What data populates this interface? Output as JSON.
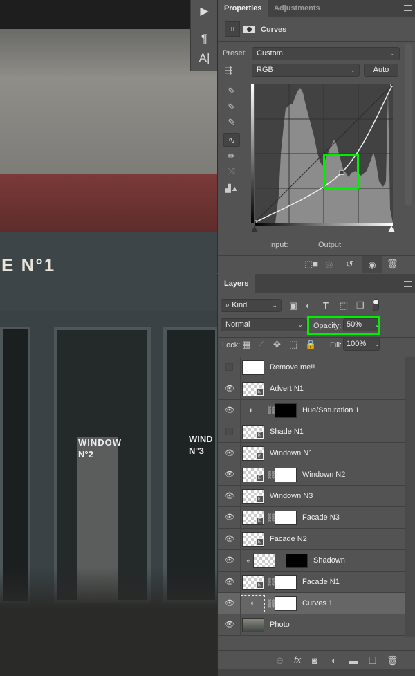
{
  "canvas": {
    "sign_text": "E N°1",
    "window2_text": "WINDOW",
    "window2_num": "N°2",
    "window3_text": "WIND",
    "window3_num": "N°3"
  },
  "toolstrip": {
    "icons": [
      "play-icon",
      "paragraph-icon",
      "character-icon"
    ],
    "paragraph": "¶",
    "character": "A|",
    "play": "▶"
  },
  "properties": {
    "tabs": [
      {
        "label": "Properties",
        "active": true
      },
      {
        "label": "Adjustments",
        "active": false
      }
    ],
    "title": "Curves",
    "preset_label": "Preset:",
    "preset_value": "Custom",
    "channel_value": "RGB",
    "auto_label": "Auto",
    "input_label": "Input:",
    "output_label": "Output:",
    "curve": {
      "points": [
        [
          0,
          0
        ],
        [
          161,
          93
        ],
        [
          255,
          255
        ]
      ],
      "range": [
        0,
        255
      ]
    },
    "highlight_color": "#00ee00"
  },
  "layers_panel": {
    "tab": "Layers",
    "filter_kind": "Kind",
    "blend_mode": "Normal",
    "opacity_label": "Opacity:",
    "opacity_value": "50%",
    "lock_label": "Lock:",
    "fill_label": "Fill:",
    "fill_value": "100%",
    "layers": [
      {
        "name": "Remove me!!",
        "visible": false,
        "type": "fill"
      },
      {
        "name": "Advert N1",
        "visible": true,
        "type": "smart"
      },
      {
        "name": "Hue/Saturation 1",
        "visible": true,
        "type": "adjust-black-mask"
      },
      {
        "name": "Shade N1",
        "visible": false,
        "type": "smart"
      },
      {
        "name": "Windown N1",
        "visible": true,
        "type": "smart"
      },
      {
        "name": "Windown N2",
        "visible": true,
        "type": "smart-mask"
      },
      {
        "name": "Windown N3",
        "visible": true,
        "type": "smart"
      },
      {
        "name": "Facade N3",
        "visible": true,
        "type": "smart-mask"
      },
      {
        "name": "Facade N2",
        "visible": true,
        "type": "smart"
      },
      {
        "name": "Shadown",
        "visible": true,
        "type": "clipped-black-mask"
      },
      {
        "name": "Facade N1",
        "visible": true,
        "type": "smart-mask",
        "underlined": true
      },
      {
        "name": "Curves 1",
        "visible": true,
        "type": "adjust-mask",
        "selected": true
      },
      {
        "name": "Photo",
        "visible": true,
        "type": "photo"
      }
    ]
  }
}
